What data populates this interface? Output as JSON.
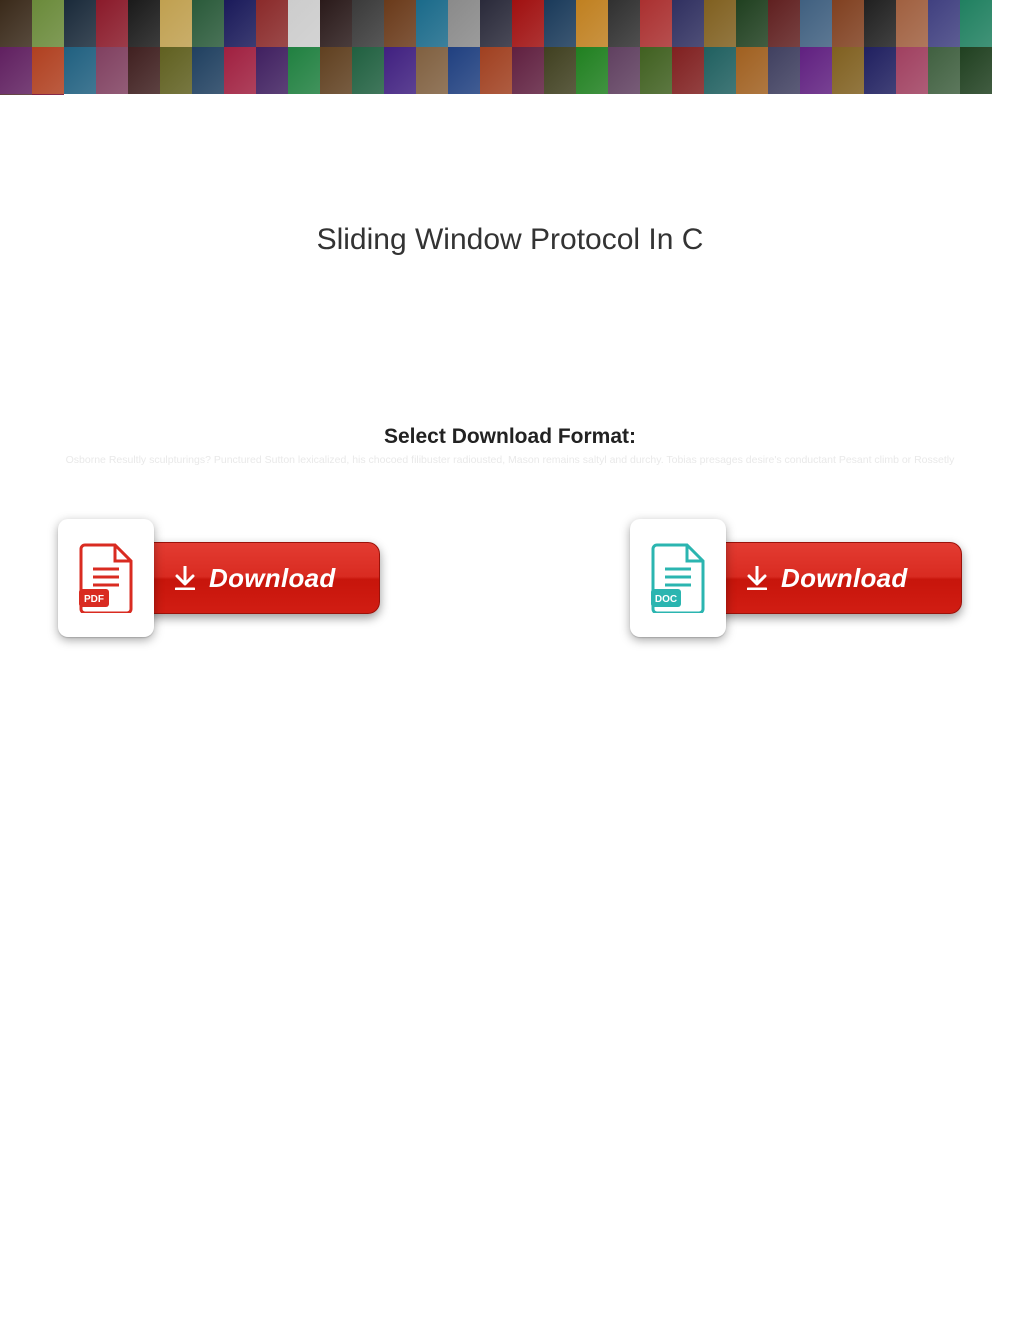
{
  "banner": {
    "covers": [
      "#3a2a1a",
      "#6a8a3a",
      "#1a2a3a",
      "#8a1a2a",
      "#1a1a1a",
      "#c0a050",
      "#2a5a3a",
      "#1a1a5a",
      "#8a2a2a",
      "#cccccc",
      "#2a1a1a",
      "#3a3a3a",
      "#6a3a1a",
      "#1a6a8a",
      "#8a8a8a",
      "#2a2a3a",
      "#a01010",
      "#1a3a5a",
      "#c08020",
      "#303030",
      "#aa3030",
      "#303060",
      "#806020",
      "#204020",
      "#602020",
      "#406080",
      "#804020",
      "#202020",
      "#a06040",
      "#404080",
      "#208060",
      "#602060",
      "#b04020",
      "#206080",
      "#804060",
      "#402020",
      "#606020",
      "#204060",
      "#a02040",
      "#402060",
      "#208040",
      "#604020",
      "#206040",
      "#402080",
      "#806040",
      "#204080",
      "#a04020",
      "#602040",
      "#404020",
      "#208020",
      "#604060",
      "#406020",
      "#802020",
      "#206060",
      "#a06020",
      "#404060",
      "#602080",
      "#806020",
      "#202060",
      "#a04060",
      "#406040",
      "#204020",
      "#604040",
      "#802040"
    ]
  },
  "title": "Sliding Window Protocol In C",
  "subheading": "Select Download Format:",
  "faint_text": "Osborne Resultly sculpturings? Punctured Sutton lexicalized, his chocoed filibuster radiousted, Mason remains saltyl and durchy. Tobias presages desire's conductant Pesant climb or Rossetly",
  "downloads": {
    "pdf": {
      "label": "Download",
      "badge": "PDF",
      "icon_color": "#d92b21",
      "pill_bg": "#d92b21"
    },
    "doc": {
      "label": "Download",
      "badge": "DOC",
      "icon_color": "#2bb5b0",
      "pill_bg": "#d92b21"
    }
  }
}
